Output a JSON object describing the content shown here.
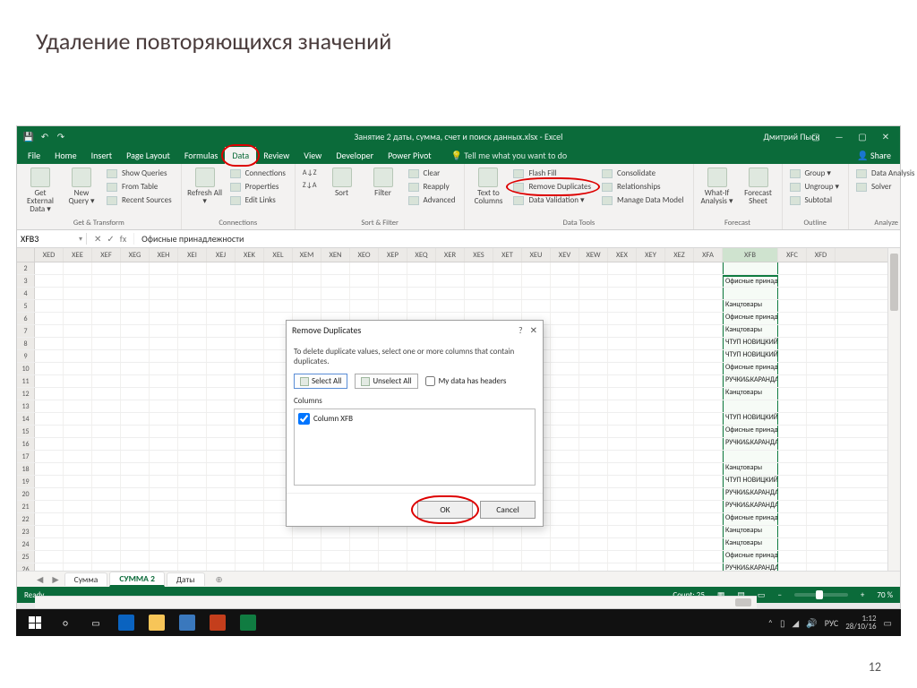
{
  "slide": {
    "title": "Удаление повторяющихся значений",
    "page": "12"
  },
  "titlebar": {
    "title": "Занятие 2 даты, сумма, счет и поиск данных.xlsx - Excel",
    "user": "Дмитрий Пыск"
  },
  "tabs": {
    "file": "File",
    "home": "Home",
    "insert": "Insert",
    "page_layout": "Page Layout",
    "formulas": "Formulas",
    "data": "Data",
    "review": "Review",
    "view": "View",
    "developer": "Developer",
    "power_pivot": "Power Pivot",
    "tell_me": "Tell me what you want to do",
    "share": "Share"
  },
  "ribbon": {
    "get_transform": {
      "get_external": "Get External Data ▾",
      "new_query": "New Query ▾",
      "show_queries": "Show Queries",
      "from_table": "From Table",
      "recent": "Recent Sources",
      "label": "Get & Transform"
    },
    "connections": {
      "refresh": "Refresh All ▾",
      "connections": "Connections",
      "properties": "Properties",
      "edit_links": "Edit Links",
      "label": "Connections"
    },
    "sort_filter": {
      "sort": "Sort",
      "filter": "Filter",
      "clear": "Clear",
      "reapply": "Reapply",
      "advanced": "Advanced",
      "label": "Sort & Filter"
    },
    "data_tools": {
      "text_to_columns": "Text to Columns",
      "flash_fill": "Flash Fill",
      "remove_duplicates": "Remove Duplicates",
      "data_validation": "Data Validation ▾",
      "consolidate": "Consolidate",
      "relationships": "Relationships",
      "manage_model": "Manage Data Model",
      "label": "Data Tools"
    },
    "forecast": {
      "what_if": "What-If Analysis ▾",
      "forecast_sheet": "Forecast Sheet",
      "label": "Forecast"
    },
    "outline": {
      "group": "Group ▾",
      "ungroup": "Ungroup ▾",
      "subtotal": "Subtotal",
      "label": "Outline"
    },
    "analyze": {
      "data_analysis": "Data Analysis",
      "solver": "Solver",
      "label": "Analyze"
    }
  },
  "formula_bar": {
    "namebox": "XFB3",
    "fx": "fx",
    "value": "Офисные принадлежности"
  },
  "columns": [
    "XED",
    "XEE",
    "XEF",
    "XEG",
    "XEH",
    "XEI",
    "XEJ",
    "XEK",
    "XEL",
    "XEM",
    "XEN",
    "XEO",
    "XEP",
    "XEQ",
    "XER",
    "XES",
    "XET",
    "XEU",
    "XEV",
    "XEW",
    "XEX",
    "XEY",
    "XEZ",
    "XFA",
    "XFB",
    "XFC",
    "XFD"
  ],
  "sel_col": "XFB",
  "row_data": {
    "3": "Офисные принадлежности",
    "4": "",
    "5": "Канцтовары",
    "6": "Офисные принадлежности",
    "7": "Канцтовары",
    "8": "ЧТУП НОВИЦКИЙ",
    "9": "ЧТУП НОВИЦКИЙ",
    "10": "Офисные принадлежности",
    "11": "РУЧКИ&КАРАНДАШИ",
    "12": "Канцтовары",
    "13": "",
    "14": "ЧТУП НОВИЦКИЙ",
    "15": "Офисные принадлежности",
    "16": "РУЧКИ&КАРАНДАШИ",
    "17": "",
    "18": "Канцтовары",
    "19": "ЧТУП НОВИЦКИЙ",
    "20": "РУЧКИ&КАРАНДАШИ",
    "21": "РУЧКИ&КАРАНДАШИ",
    "22": "Офисные принадлежности",
    "23": "Канцтовары",
    "24": "Канцтовары",
    "25": "Офисные принадлежности",
    "26": "РУЧКИ&КАРАНДАШИ"
  },
  "dialog": {
    "title": "Remove Duplicates",
    "hint": "To delete duplicate values, select one or more columns that contain duplicates.",
    "select_all": "Select All",
    "unselect_all": "Unselect All",
    "headers": "My data has headers",
    "columns_label": "Columns",
    "column_item": "Column XFB",
    "ok": "OK",
    "cancel": "Cancel"
  },
  "sheets": {
    "s1": "Сумма",
    "s2": "СУММА 2",
    "s3": "Даты",
    "add": "⊕"
  },
  "status": {
    "ready": "Ready",
    "count": "Count: 25",
    "zoom": "70 %"
  },
  "taskbar": {
    "lang": "РУС",
    "time": "1:12",
    "date": "28/10/16"
  }
}
